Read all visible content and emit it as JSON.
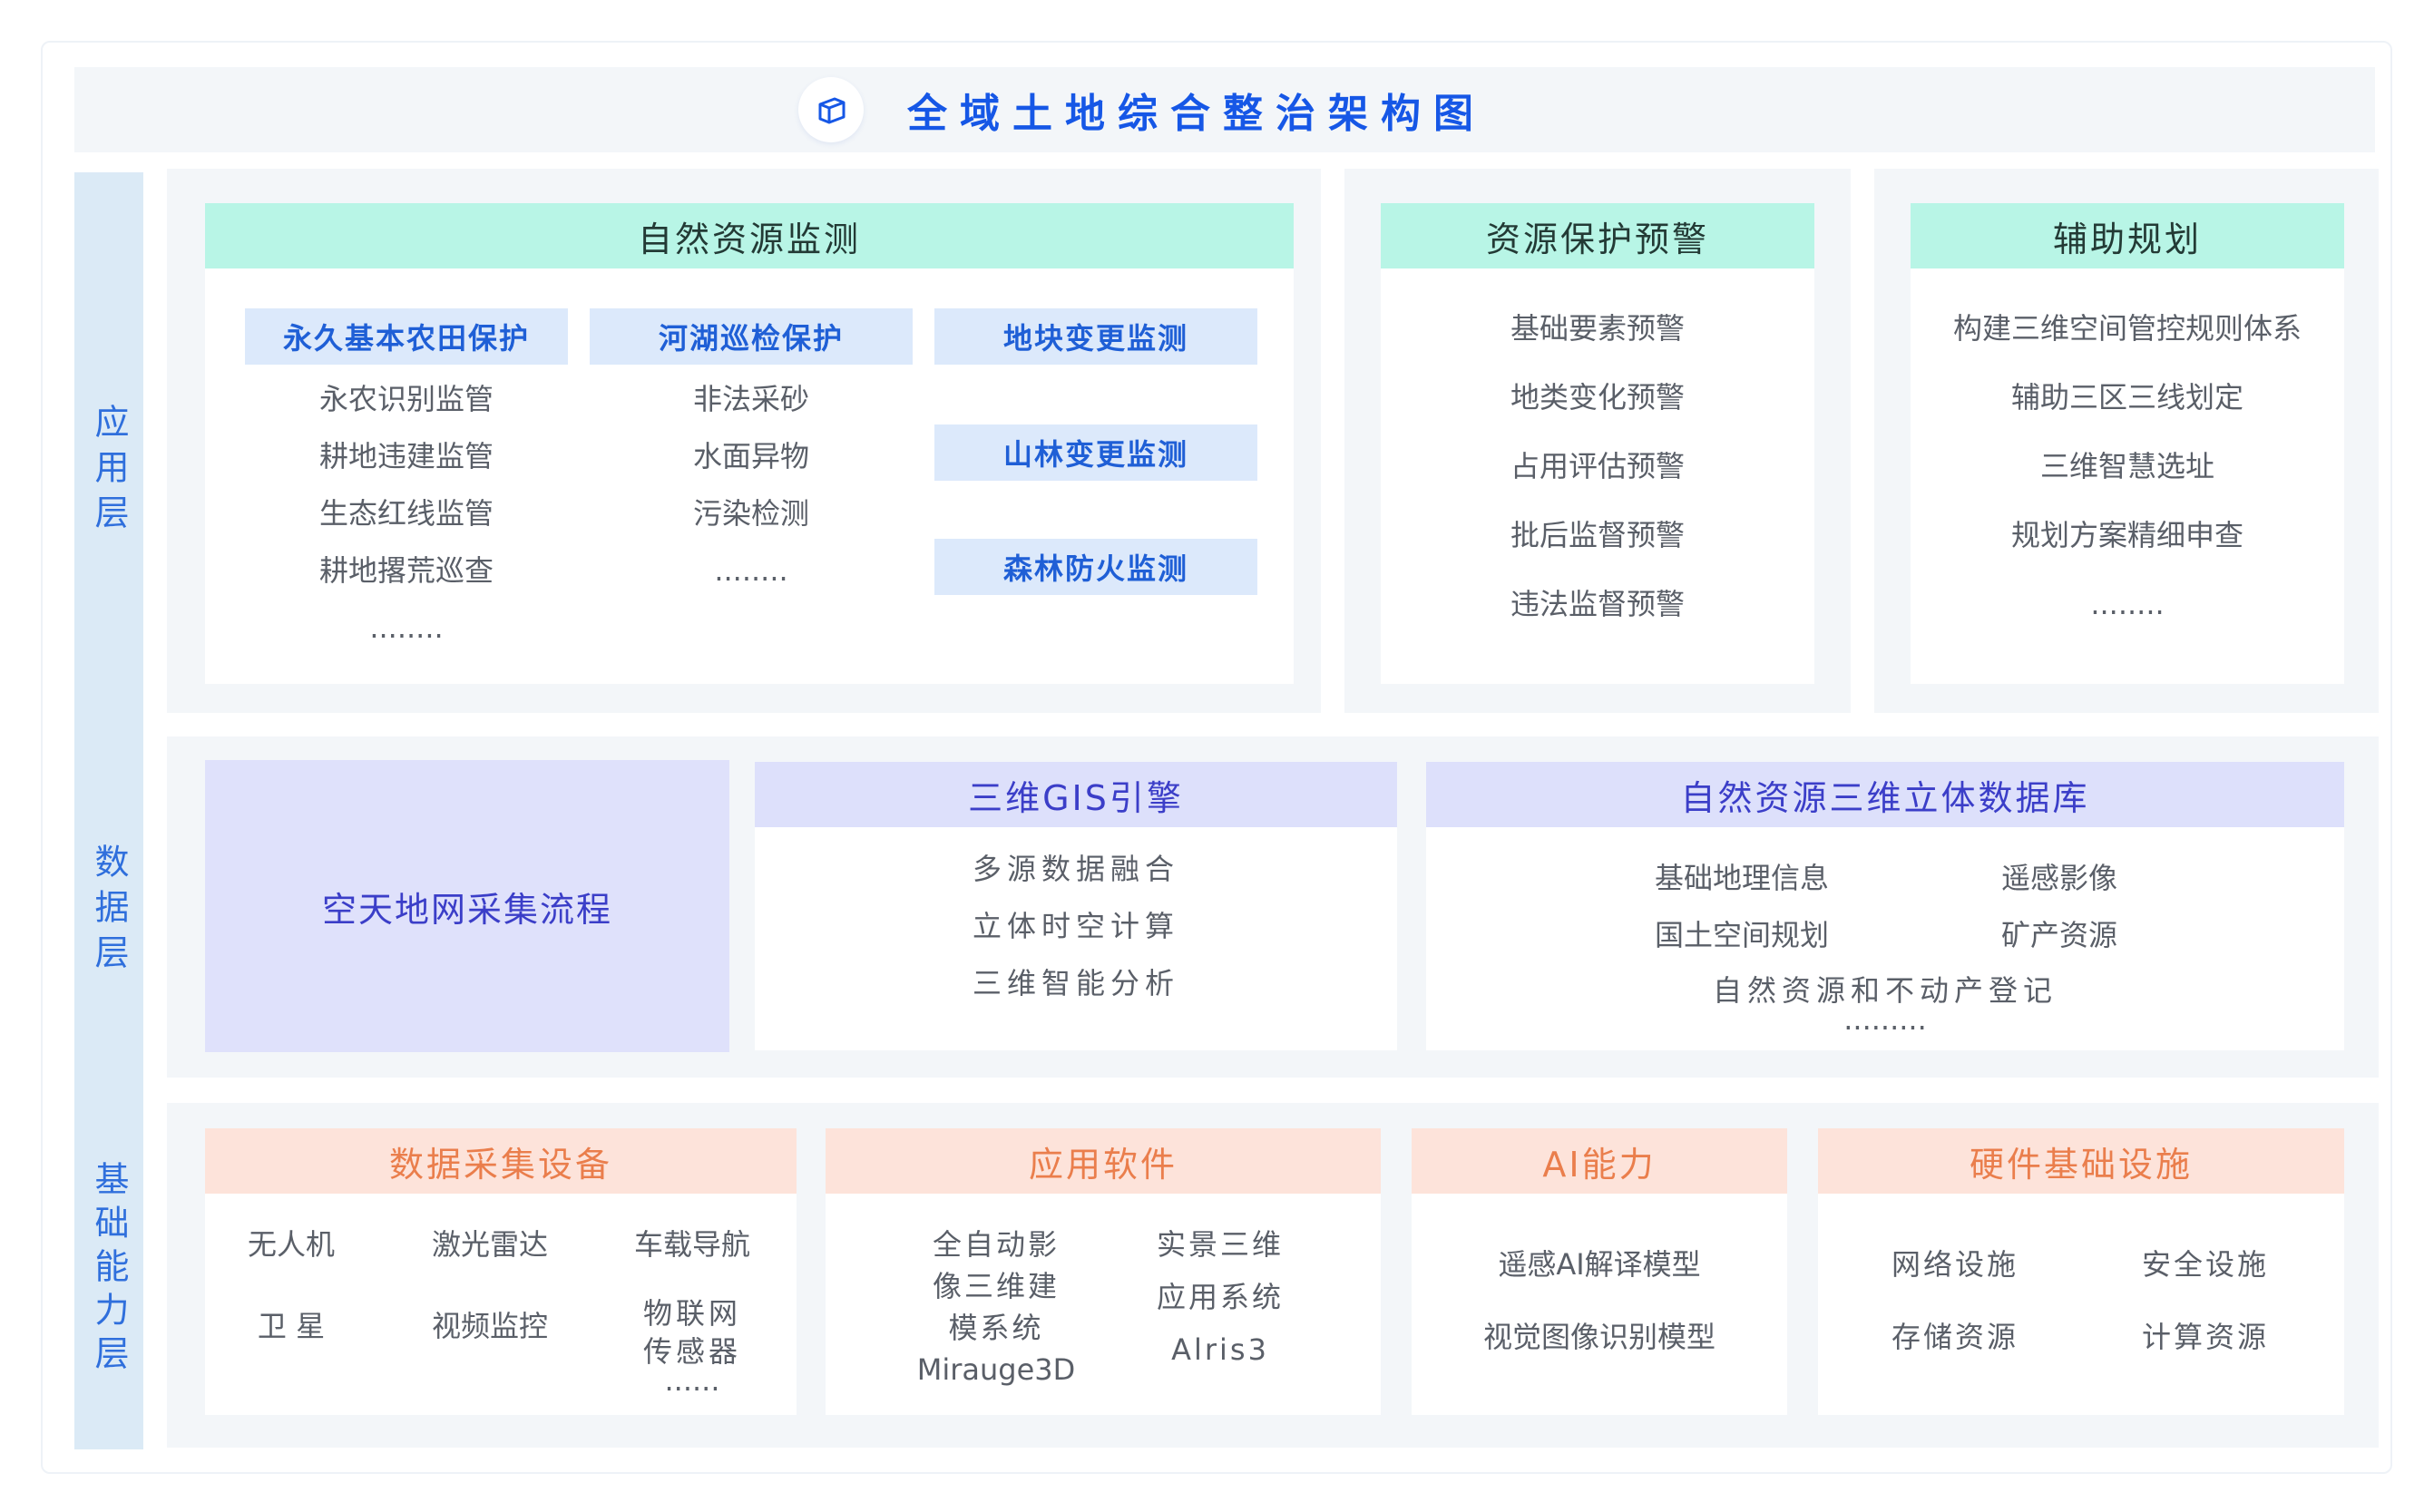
{
  "title": "全域土地综合整治架构图",
  "layers": {
    "application": "应用层",
    "data": "数据层",
    "foundation": "基础能力层"
  },
  "natural_resource_monitoring": {
    "title": "自然资源监测",
    "farmland": {
      "title": "永久基本农田保护",
      "items": [
        "永农识别监管",
        "耕地违建监管",
        "生态红线监管",
        "耕地撂荒巡查",
        "........"
      ]
    },
    "river": {
      "title": "河湖巡检保护",
      "items": [
        "非法采砂",
        "水面异物",
        "污染检测",
        "........"
      ]
    },
    "parcel": {
      "title": "地块变更监测"
    },
    "mountain": {
      "title": "山林变更监测"
    },
    "forest_fire": {
      "title": "森林防火监测"
    }
  },
  "protection_warning": {
    "title": "资源保护预警",
    "items": [
      "基础要素预警",
      "地类变化预警",
      "占用评估预警",
      "批后监督预警",
      "违法监督预警"
    ]
  },
  "planning_aid": {
    "title": "辅助规划",
    "items": [
      "构建三维空间管控规则体系",
      "辅助三区三线划定",
      "三维智慧选址",
      "规划方案精细申查",
      "........"
    ]
  },
  "collection_flow": {
    "title": "空天地网采集流程"
  },
  "gis_engine": {
    "title": "三维GIS引擎",
    "items": [
      "多源数据融合",
      "立体时空计算",
      "三维智能分析"
    ]
  },
  "database": {
    "title": "自然资源三维立体数据库",
    "items": [
      "基础地理信息",
      "遥感影像",
      "国土空间规划",
      "矿产资源",
      "自然资源和不动产登记",
      "........."
    ]
  },
  "collection_devices": {
    "title": "数据采集设备",
    "items": [
      "无人机",
      "激光雷达",
      "车载导航",
      "卫 星",
      "视频监控",
      "物联网",
      "传感器",
      "......"
    ]
  },
  "software": {
    "title": "应用软件",
    "items": [
      "全自动影",
      "像三维建",
      "模系统",
      "Mirauge3D",
      "实景三维",
      "应用系统",
      "Alris3"
    ]
  },
  "ai": {
    "title": "AI能力",
    "items": [
      "遥感AI解译模型",
      "视觉图像识别模型"
    ]
  },
  "hardware": {
    "title": "硬件基础设施",
    "items": [
      "网络设施",
      "安全设施",
      "存储资源",
      "计算资源"
    ]
  },
  "colors": {
    "title_blue": "#1657e6",
    "layer_strip": "#dbeaf6",
    "header_green": "#b8f5e6",
    "header_purple": "#dde0fb",
    "header_orange": "#fde3da",
    "orange_text": "#ea7e4c",
    "sub_header_blue": "#dce9fb"
  },
  "icons": {
    "title": "cube-icon"
  }
}
